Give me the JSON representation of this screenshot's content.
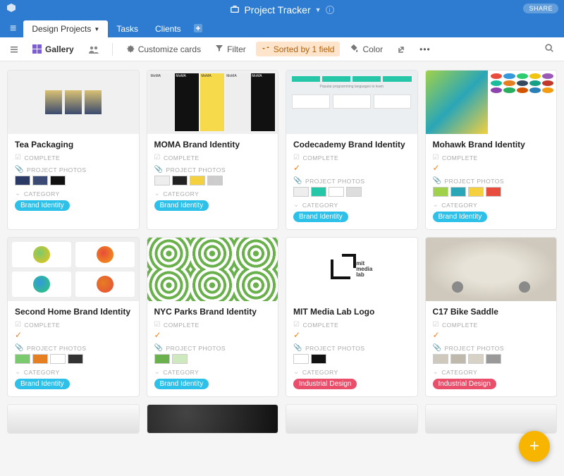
{
  "header": {
    "app_title": "Project Tracker",
    "share_label": "SHARE"
  },
  "tabs": [
    {
      "label": "Design Projects",
      "active": true
    },
    {
      "label": "Tasks",
      "active": false
    },
    {
      "label": "Clients",
      "active": false
    }
  ],
  "toolbar": {
    "view_name": "Gallery",
    "customize": "Customize cards",
    "filter": "Filter",
    "sorted": "Sorted by 1 field",
    "color": "Color"
  },
  "field_labels": {
    "complete": "COMPLETE",
    "project_photos": "PROJECT PHOTOS",
    "category": "CATEGORY"
  },
  "categories": {
    "brand_identity": "Brand Identity",
    "industrial_design": "Industrial Design"
  },
  "cards": [
    {
      "title": "Tea Packaging",
      "complete": false,
      "category": "brand_identity",
      "preview": "tea",
      "thumbs": 3
    },
    {
      "title": "MOMA Brand Identity",
      "complete": false,
      "category": "brand_identity",
      "preview": "moma",
      "thumbs": 4
    },
    {
      "title": "Codecademy Brand Identity",
      "complete": true,
      "category": "brand_identity",
      "preview": "code",
      "thumbs": 4
    },
    {
      "title": "Mohawk Brand Identity",
      "complete": true,
      "category": "brand_identity",
      "preview": "mohawk",
      "thumbs": 4
    },
    {
      "title": "Second Home Brand Identity",
      "complete": true,
      "category": "brand_identity",
      "preview": "second",
      "thumbs": 4
    },
    {
      "title": "NYC Parks Brand Identity",
      "complete": true,
      "category": "brand_identity",
      "preview": "parks",
      "thumbs": 2
    },
    {
      "title": "MIT Media Lab Logo",
      "complete": true,
      "category": "industrial_design",
      "preview": "mit",
      "thumbs": 2
    },
    {
      "title": "C17 Bike Saddle",
      "complete": true,
      "category": "industrial_design",
      "preview": "bike",
      "thumbs": 4
    }
  ],
  "mohawk_dot_colors": [
    "#e74c3c",
    "#3498db",
    "#2ecc71",
    "#f1c40f",
    "#9b59b6",
    "#1abc9c",
    "#e67e22",
    "#34495e",
    "#16a085",
    "#c0392b",
    "#8e44ad",
    "#27ae60",
    "#d35400",
    "#2980b9",
    "#f39c12"
  ]
}
